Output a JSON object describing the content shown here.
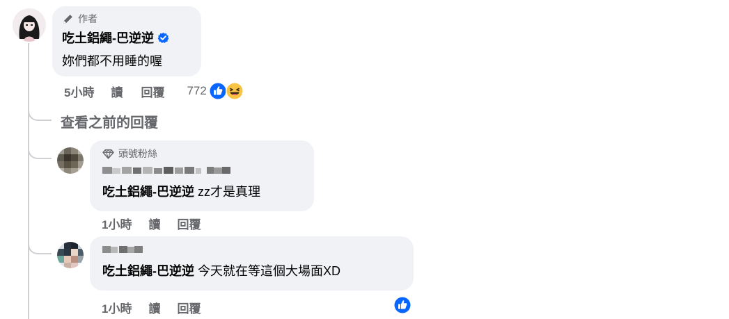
{
  "comments": [
    {
      "badge": "作者",
      "badge_icon": "pen-icon",
      "name": "吃土鋁繩-巴逆逆",
      "verified": true,
      "text": "妳們都不用睡的喔",
      "time": "5小時",
      "read": "讀",
      "reply": "回覆",
      "reaction_count": "772",
      "reactions": [
        "like-icon",
        "haha-icon"
      ]
    },
    {
      "badge": "頭號粉絲",
      "badge_icon": "diamond-icon",
      "mention": "吃土鋁繩-巴逆逆",
      "text": " zz才是真理",
      "time": "1小時",
      "read": "讀",
      "reply": "回覆"
    },
    {
      "mention": "吃土鋁繩-巴逆逆",
      "text": " 今天就在等這個大場面XD",
      "time": "1小時",
      "read": "讀",
      "reply": "回覆",
      "reactions": [
        "like-icon"
      ]
    }
  ],
  "view_previous": "查看之前的回覆",
  "colors": {
    "bubble": "#f0f2f5",
    "thread_line": "#ced0d4",
    "secondary_text": "#65676b",
    "like_blue": "#0866ff",
    "verified_blue": "#0866ff"
  }
}
